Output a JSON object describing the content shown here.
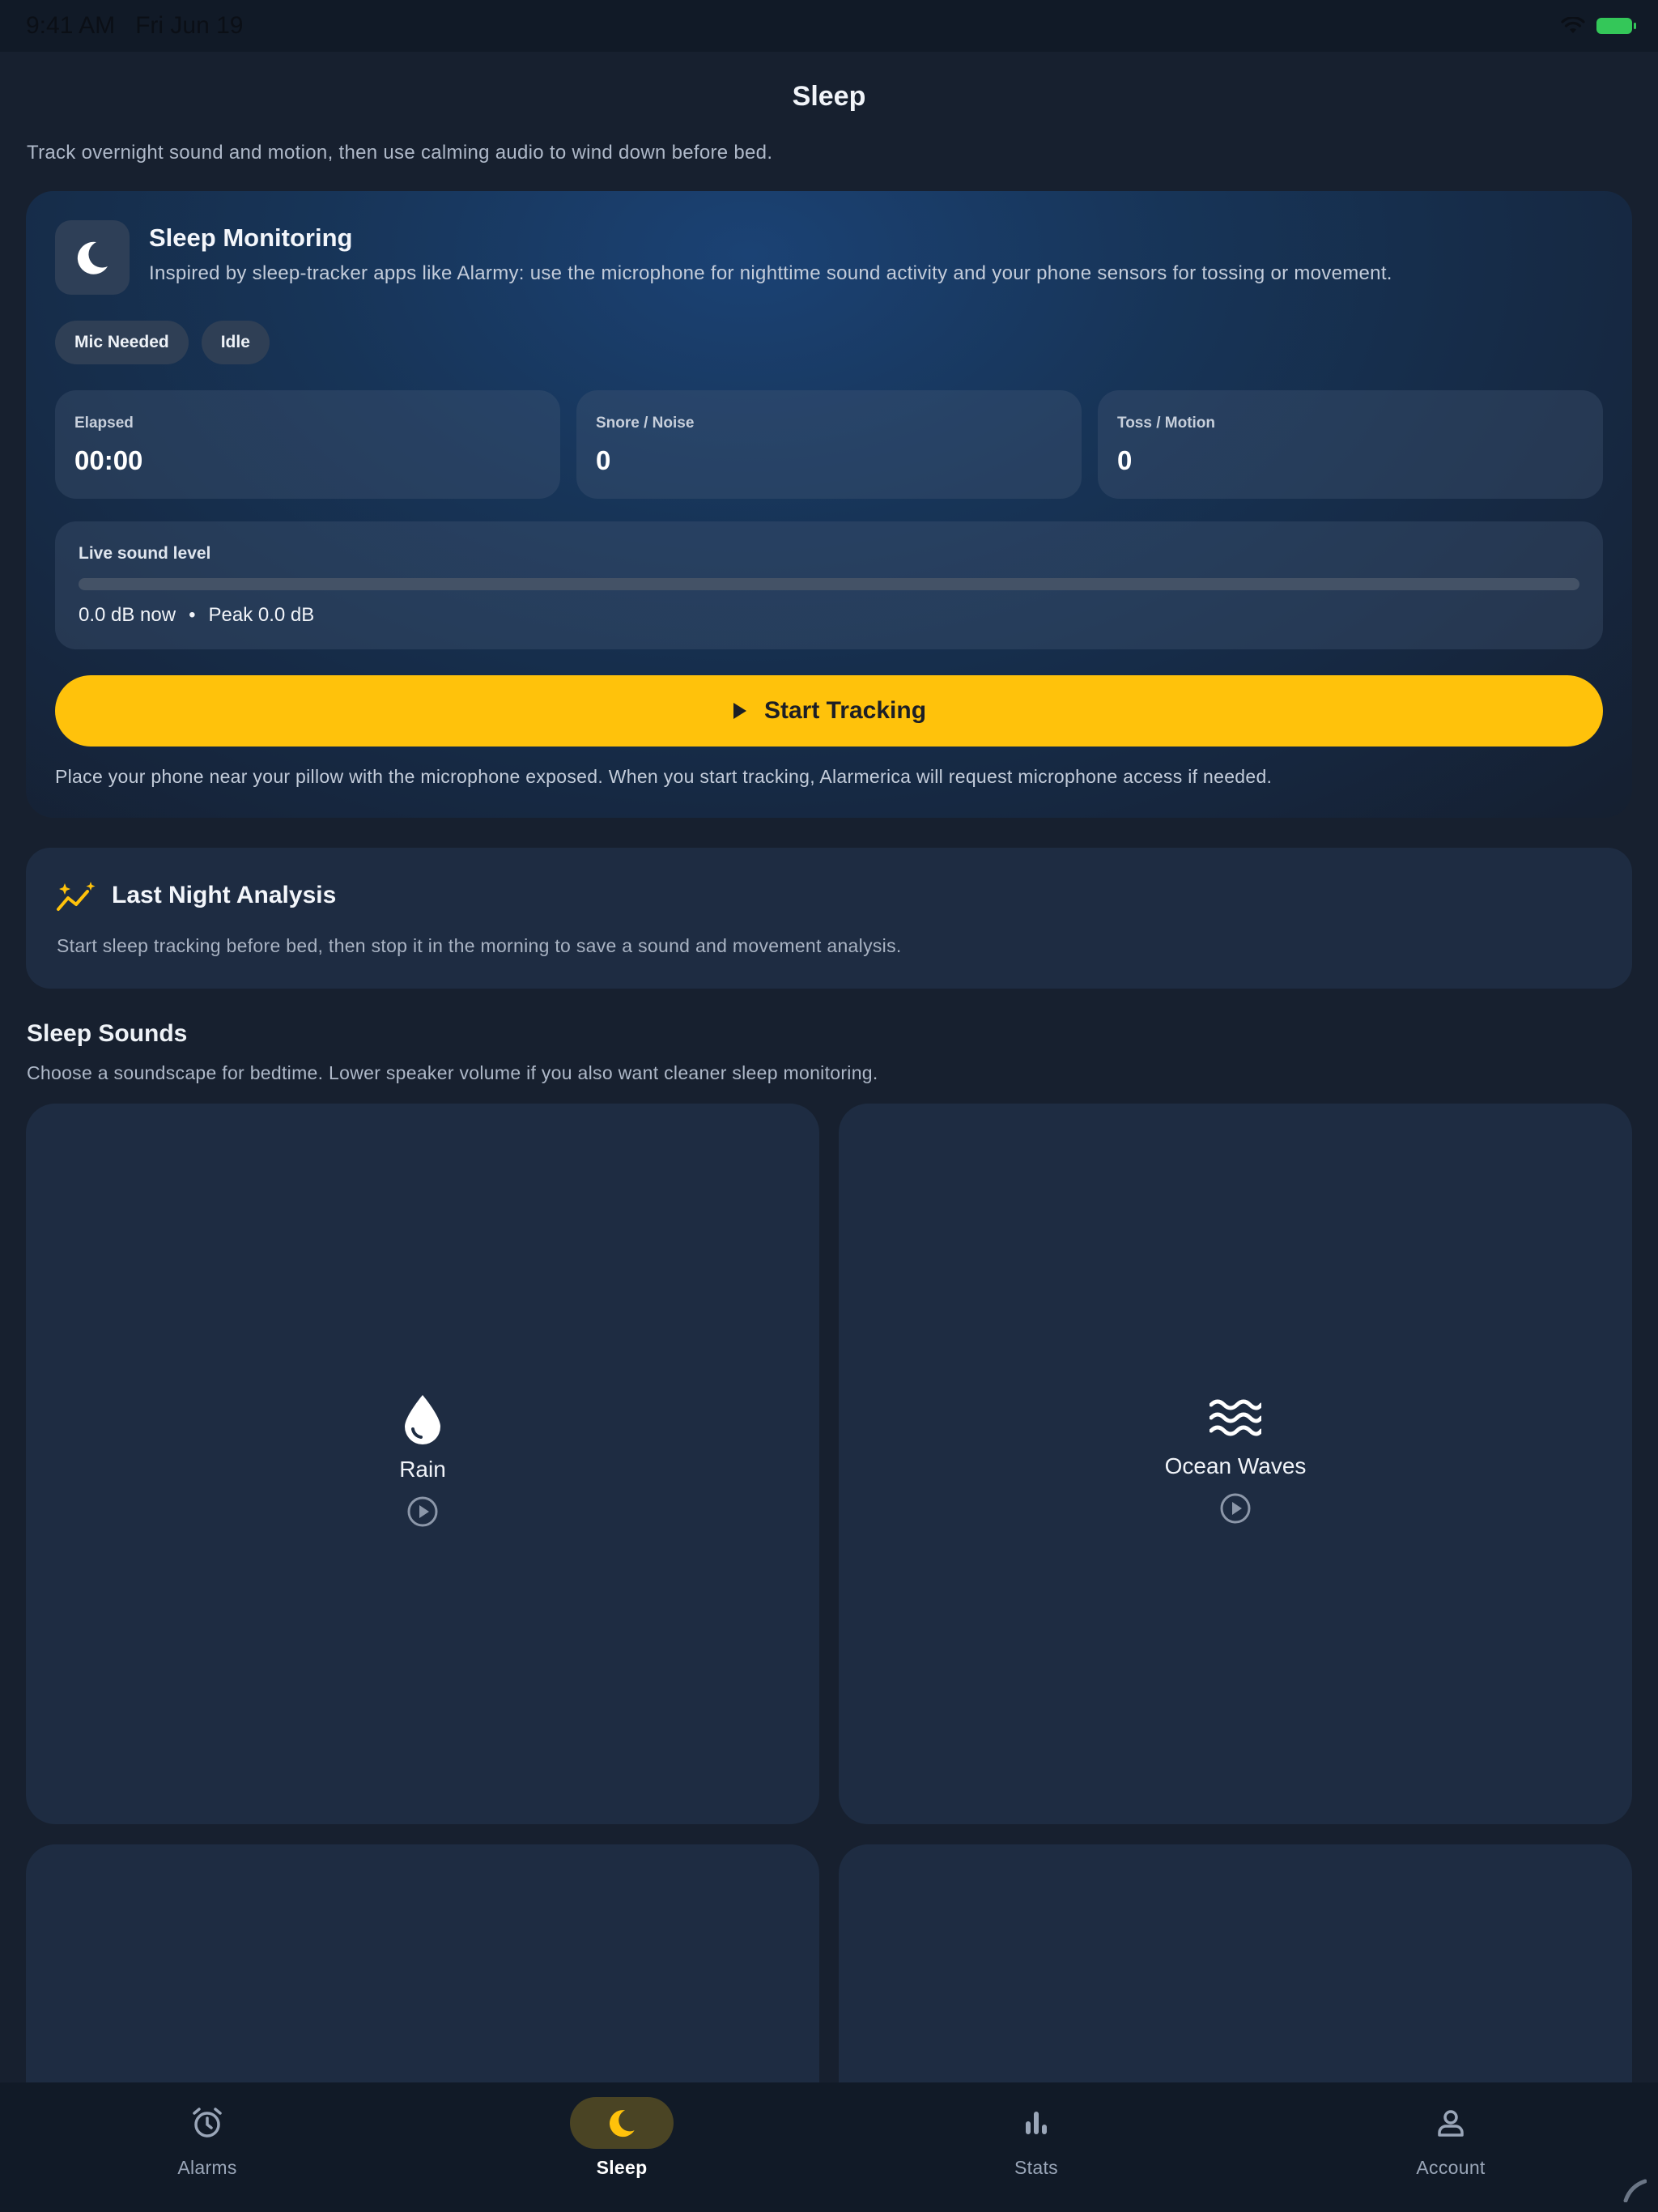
{
  "status_bar": {
    "time": "9:41 AM",
    "date": "Fri Jun 19"
  },
  "header": {
    "title": "Sleep",
    "subtitle": "Track overnight sound and motion, then use calming audio to wind down before bed."
  },
  "monitoring": {
    "title": "Sleep Monitoring",
    "description": "Inspired by sleep-tracker apps like Alarmy: use the microphone for nighttime sound activity and your phone sensors for tossing or movement.",
    "chips": [
      "Mic Needed",
      "Idle"
    ],
    "stats": [
      {
        "label": "Elapsed",
        "value": "00:00"
      },
      {
        "label": "Snore / Noise",
        "value": "0"
      },
      {
        "label": "Toss / Motion",
        "value": "0"
      }
    ],
    "live_level": {
      "label": "Live sound level",
      "level_fraction": 0,
      "now_text": "0.0 dB now",
      "separator": "•",
      "peak_text": "Peak 0.0 dB"
    },
    "start_button": "Start Tracking",
    "hint": "Place your phone near your pillow with the microphone exposed. When you start tracking, Alarmerica will request microphone access if needed."
  },
  "analysis": {
    "title": "Last Night Analysis",
    "description": "Start sleep tracking before bed, then stop it in the morning to save a sound and movement analysis."
  },
  "sounds": {
    "title": "Sleep Sounds",
    "description": "Choose a soundscape for bedtime. Lower speaker volume if you also want cleaner sleep monitoring.",
    "items": [
      {
        "name": "Rain",
        "icon": "water-drop-icon"
      },
      {
        "name": "Ocean Waves",
        "icon": "waves-icon"
      }
    ]
  },
  "nav": {
    "items": [
      {
        "label": "Alarms",
        "icon": "alarm-clock-icon"
      },
      {
        "label": "Sleep",
        "icon": "moon-icon",
        "active": true
      },
      {
        "label": "Stats",
        "icon": "bar-chart-icon"
      },
      {
        "label": "Account",
        "icon": "person-icon"
      }
    ]
  },
  "colors": {
    "accent": "#ffc20b",
    "background": "#17202f",
    "card": "#1e2c42",
    "nav_background": "#111a27",
    "battery": "#34c759"
  }
}
